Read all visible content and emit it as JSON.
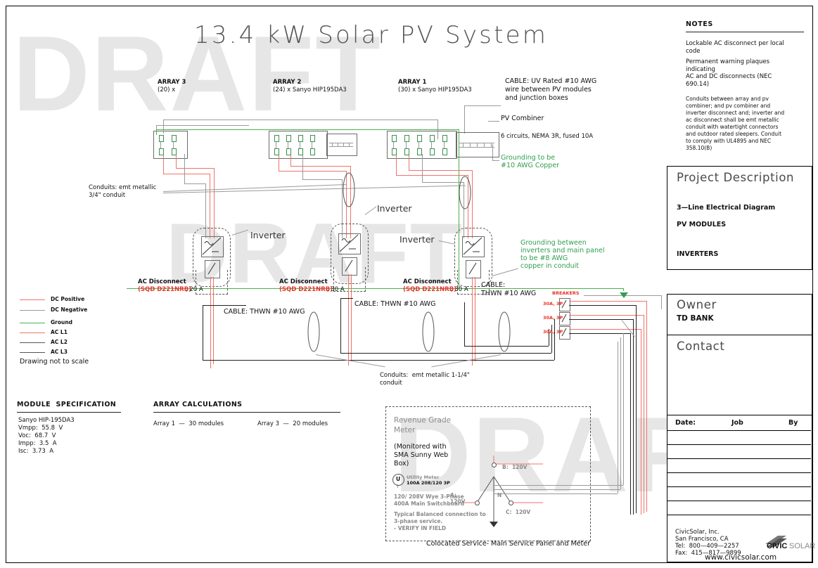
{
  "title": "13.4 kW Solar PV System",
  "watermark": "DRAFT",
  "arrays": [
    {
      "name": "ARRAY 3",
      "spec": "(20) x"
    },
    {
      "name": "ARRAY 2",
      "spec": "(24) x Sanyo HIP195DA3"
    },
    {
      "name": "ARRAY 1",
      "spec": "(30) x Sanyo HIP195DA3"
    }
  ],
  "callouts": {
    "cable_pv": "CABLE: UV Rated #10 AWG\nwire between PV modules\nand junction boxes",
    "pv_combiner": "PV Combiner",
    "pv_combiner_detail": "6 circuits, NEMA 3R, fused 10A",
    "grounding_combiner": "Grounding to be\n#10 AWG Copper",
    "conduit_upper": "Conduits: emt metallic\n3/4\" conduit",
    "conduit_lower": "Conduits:  emt metallic 1-1/4\"\nconduit",
    "grounding_inverters": "Grounding between\ninverters and main panel\nto be #8 AWG\ncopper in conduit",
    "inverter": "Inverter",
    "breakers": "BREAKERS",
    "breaker_rating": "30A, 3P",
    "cable_thwn": "CABLE: THWN #10 AWG",
    "cable_thwn_short": "CABLE:\nTHWN #10 AWG"
  },
  "disconnects": [
    {
      "label": "AC Disconnect",
      "part": "(SQD D221NRB)",
      "amps": ", 20 A"
    },
    {
      "label": "AC Disconnect",
      "part": "(SQD D221NRB)",
      "amps": ", 30 A"
    },
    {
      "label": "AC Disconnect",
      "part": "(SQD D221NRB)",
      "amps": ", 30 A"
    }
  ],
  "legend": {
    "items": [
      {
        "label": "DC Positive",
        "color": "#f0736a"
      },
      {
        "label": "DC Negative",
        "color": "#9a9a9a"
      },
      {
        "label": "Ground",
        "color": "#4caf50"
      },
      {
        "label": "AC L1",
        "color": "#f0736a"
      },
      {
        "label": "AC L2",
        "color": "#555555"
      },
      {
        "label": "AC L3",
        "color": "#555555"
      }
    ],
    "note": "Drawing not to scale"
  },
  "module_spec": {
    "heading": "MODULE  SPECIFICATION",
    "lines": [
      "Sanyo HIP-195DA3",
      "Vmpp:  55.8  V",
      "Voc:  68.7  V",
      "Impp:  3.5  A",
      "Isc:  3.73  A"
    ]
  },
  "array_calculations": {
    "heading": "ARRAY CALCULATIONS",
    "col1": "Array 1  —  30 modules",
    "col2": "Array 3  —  20 modules"
  },
  "meter_block": {
    "heading": "Revenue Grade",
    "heading2": "Meter",
    "monitored": "(Monitored with\nSMA Sunny Web\nBox)",
    "utility_meter": "Utility Meter",
    "utility_meter_detail": "100A 208/120 3P",
    "utility_symbol": "U",
    "switchboard": "120/ 208V Wye 3-Phase\n400A Main Switchboard",
    "typical": "Typical Balanced connection to\n3-phase service.\n- VERIFY IN FIELD",
    "phase_a": "A:\n120V",
    "phase_b": "B:  120V",
    "phase_c": "C:  120V",
    "neutral": "N",
    "caption": "Colocated Service- Main Service Panel and Meter"
  },
  "notes": {
    "heading": "NOTES",
    "items": [
      "Lockable AC disconnect per local\ncode",
      "Permanent warning plaques\nindicating\nAC and DC disconnects (NEC\n690.14)",
      "Conduits between array and pv\ncombiner; and pv combiner and\ninverter disconnect and; inverter and\nac disconnect shall be emt metallic\nconduit with watertight connectors\nand outdoor rated sleepers. Conduit\nto comply with UL4895 and NEC\n358.10(B)"
    ]
  },
  "title_block": {
    "project_heading": "Project Description",
    "project_lines": [
      "3—Line Electrical Diagram",
      "PV MODULES",
      "INVERTERS"
    ],
    "owner_heading": "Owner",
    "owner_value": "TD BANK",
    "contact_heading": "Contact",
    "revision_cols": [
      "Date:",
      "Job",
      "By"
    ],
    "company": {
      "name": "CivicSolar, Inc.",
      "city": "San Francisco, CA",
      "tel": "Tel:  800—409—2257",
      "fax": "Fax:  415—817—9899",
      "web": "www.civicsolar.com",
      "logo_bold": "CIVIC",
      "logo_light": "SOLAR"
    }
  }
}
